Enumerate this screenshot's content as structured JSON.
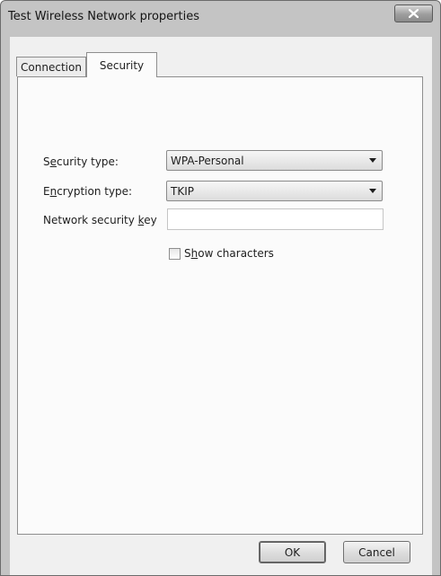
{
  "window": {
    "title": "Test Wireless Network properties",
    "close_icon": "close-icon"
  },
  "tabs": [
    {
      "label": "Connection",
      "selected": false
    },
    {
      "label": "Security",
      "selected": true
    }
  ],
  "security": {
    "security_type_label_pre": "S",
    "security_type_label_mnemonic": "e",
    "security_type_label_post": "curity type:",
    "security_type_value": "WPA-Personal",
    "encryption_type_label_pre": "E",
    "encryption_type_label_mnemonic": "n",
    "encryption_type_label_post": "cryption type:",
    "encryption_type_value": "TKIP",
    "network_key_label_pre": "Network security ",
    "network_key_label_mnemonic": "k",
    "network_key_label_post": "ey",
    "network_key_value": "",
    "show_characters_pre": "S",
    "show_characters_mnemonic": "h",
    "show_characters_post": "ow characters",
    "show_characters_checked": false
  },
  "buttons": {
    "ok": "OK",
    "cancel": "Cancel"
  }
}
